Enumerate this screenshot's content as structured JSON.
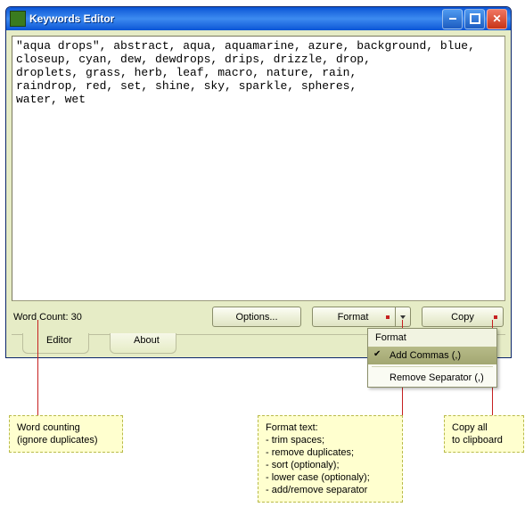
{
  "titlebar": {
    "title": "Keywords Editor"
  },
  "editor": {
    "text": "\"aqua drops\", abstract, aqua, aquamarine, azure, background, blue,\ncloseup, cyan, dew, dewdrops, drips, drizzle, drop,\ndroplets, grass, herb, leaf, macro, nature, rain,\nraindrop, red, set, shine, sky, sparkle, spheres,\nwater, wet"
  },
  "status": {
    "word_count_label": "Word Count: 30"
  },
  "buttons": {
    "options": "Options...",
    "format": "Format",
    "copy": "Copy"
  },
  "tabs": {
    "editor": "Editor",
    "about": "About"
  },
  "menu": {
    "header": "Format",
    "add_commas": "Add Commas (,)",
    "remove_sep": "Remove Separator (,)"
  },
  "callouts": {
    "wc": "Word counting\n(ignore duplicates)",
    "fmt": "Format text:\n- trim spaces;\n- remove duplicates;\n- sort (optionaly);\n- lower case (optionaly);\n- add/remove separator",
    "copy": "Copy all\nto clipboard"
  }
}
